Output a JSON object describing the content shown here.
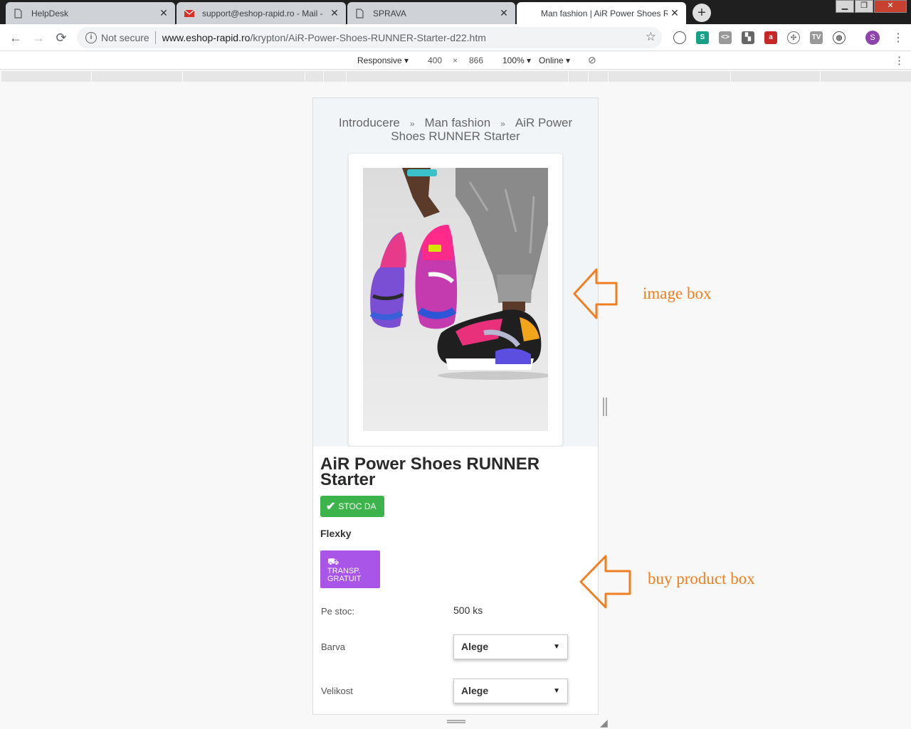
{
  "browser": {
    "tabs": [
      {
        "title": "HelpDesk",
        "active": false
      },
      {
        "title": "support@eshop-rapid.ro - Mail -",
        "active": false
      },
      {
        "title": "SPRAVA",
        "active": false
      },
      {
        "title": "Man fashion | AiR Power Shoes R",
        "active": true
      }
    ],
    "new_tab_label": "+",
    "security_label": "Not secure",
    "url_host": "www.eshop-rapid.ro",
    "url_path": "/krypton/AiR-Power-Shoes-RUNNER-Starter-d22.htm",
    "profile_initial": "S"
  },
  "device_toolbar": {
    "mode": "Responsive",
    "width": "400",
    "times": "×",
    "height": "866",
    "zoom": "100%",
    "network": "Online"
  },
  "page": {
    "breadcrumb": [
      "Introducere",
      "Man fashion",
      "AiR Power Shoes RUNNER Starter"
    ],
    "breadcrumb_separator": "»",
    "product_title": "AiR Power Shoes RUNNER Starter",
    "stock_badge": "STOC DA",
    "brand": "Flexky",
    "shipping_badge": "TRANSP. GRATUIT",
    "stock_label": "Pe stoc:",
    "stock_value": "500 ks",
    "color_label": "Barva",
    "color_select": "Alege",
    "size_label": "Velikost",
    "size_select": "Alege"
  },
  "annotations": {
    "image_box": "image box",
    "buy_box": "buy product box",
    "color": "#f07f22"
  }
}
